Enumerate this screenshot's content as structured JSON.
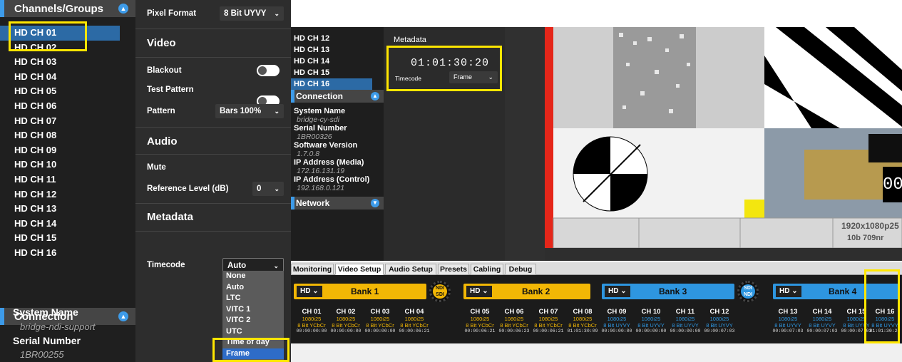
{
  "left_panel": {
    "channels_header": "Channels/Groups",
    "channels": [
      "HD CH 01",
      "HD CH 02",
      "HD CH 03",
      "HD CH 04",
      "HD CH 05",
      "HD CH 06",
      "HD CH 07",
      "HD CH 08",
      "HD CH 09",
      "HD CH 10",
      "HD CH 11",
      "HD CH 12",
      "HD CH 13",
      "HD CH 14",
      "HD CH 15",
      "HD CH 16"
    ],
    "connection_header": "Connection",
    "system_name_label": "System Name",
    "system_name": "bridge-ndi-support",
    "serial_label": "Serial Number",
    "serial": "1BR00255",
    "pixel_format_label": "Pixel Format",
    "pixel_format": "8 Bit UYVY",
    "video_header": "Video",
    "blackout_label": "Blackout",
    "test_pattern_label": "Test Pattern",
    "pattern_label": "Pattern",
    "pattern": "Bars 100%",
    "audio_header": "Audio",
    "mute_label": "Mute",
    "ref_level_label": "Reference Level (dB)",
    "ref_level": "0",
    "metadata_header": "Metadata",
    "timecode_label": "Timecode",
    "timecode_value": "Auto",
    "timecode_options": [
      "None",
      "Auto",
      "LTC",
      "VITC 1",
      "VITC 2",
      "UTC",
      "Time of day",
      "Frame"
    ]
  },
  "right_panel": {
    "channels": [
      "HD CH 12",
      "HD CH 13",
      "HD CH 14",
      "HD CH 15",
      "HD CH 16"
    ],
    "connection_header": "Connection",
    "system_name_label": "System Name",
    "system_name": "bridge-cy-sdi",
    "serial_label": "Serial Number",
    "serial": "1BR00326",
    "software_label": "Software Version",
    "software": "1.7.0.8",
    "ip_media_label": "IP Address (Media)",
    "ip_media": "172.16.131.19",
    "ip_control_label": "IP Address (Control)",
    "ip_control": "192.168.0.121",
    "network_header": "Network",
    "metadata_title": "Metadata",
    "timecode_display": "01:01:30:20",
    "timecode_label": "Timecode",
    "timecode_value": "Frame",
    "preview_texts": [
      "1920x1080p25",
      "10b 709nr",
      "00"
    ],
    "tabs": [
      "Monitoring",
      "Video Setup",
      "Audio Setup",
      "Presets",
      "Cabling",
      "Debug"
    ],
    "active_tab": "Video Setup",
    "banks": [
      {
        "dd": "HD",
        "name": "Bank 1",
        "color": "#f2b705"
      },
      {
        "dd": "HD",
        "name": "Bank 2",
        "color": "#f2b705"
      },
      {
        "dd": "HD",
        "name": "Bank 3",
        "color": "#2e96e0"
      },
      {
        "dd": "HD",
        "name": "Bank 4",
        "color": "#2e96e0"
      }
    ],
    "converters": [
      {
        "top": "NDI",
        "bottom": "SDI"
      },
      {
        "top": "SDI",
        "bottom": "NDI"
      }
    ],
    "channel_cells": [
      {
        "n": "CH 01",
        "r": "1080i25",
        "f": "8 Bit YCbCr",
        "t": "00:00:00:00"
      },
      {
        "n": "CH 02",
        "r": "1080i25",
        "f": "8 Bit YCbCr",
        "t": "00:00:00:00"
      },
      {
        "n": "CH 03",
        "r": "1080i25",
        "f": "8 Bit YCbCr",
        "t": "00:00:00:00"
      },
      {
        "n": "CH 04",
        "r": "1080i25",
        "f": "8 Bit YCbCr",
        "t": "00:00:06:21"
      },
      {
        "n": "CH 05",
        "r": "1080i25",
        "f": "8 Bit YCbCr",
        "t": "00:00:06:21"
      },
      {
        "n": "CH 06",
        "r": "1080i25",
        "f": "8 Bit YCbCr",
        "t": "00:00:06:23"
      },
      {
        "n": "CH 07",
        "r": "1080i25",
        "f": "8 Bit YCbCr",
        "t": "00:00:06:21"
      },
      {
        "n": "CH 08",
        "r": "1080i25",
        "f": "8 Bit YCbCr",
        "t": "01:01:30:09"
      },
      {
        "n": "CH 09",
        "r": "1080i25",
        "f": "8 Bit UYVY",
        "t": "00:00:00:00"
      },
      {
        "n": "CH 10",
        "r": "1080i25",
        "f": "8 Bit UYVY",
        "t": "00:00:00:00"
      },
      {
        "n": "CH 11",
        "r": "1080i25",
        "f": "8 Bit UYVY",
        "t": "00:00:00:00"
      },
      {
        "n": "CH 12",
        "r": "1080i25",
        "f": "8 Bit UYVY",
        "t": "00:00:07:03"
      },
      {
        "n": "CH 13",
        "r": "1080i25",
        "f": "8 Bit UYVY",
        "t": "00:00:07:03"
      },
      {
        "n": "CH 14",
        "r": "1080i25",
        "f": "8 Bit UYVY",
        "t": "00:00:07:03"
      },
      {
        "n": "CH 15",
        "r": "1080i25",
        "f": "8 Bit UYVY",
        "t": "00:00:07:03"
      },
      {
        "n": "CH 16",
        "r": "1080i25",
        "f": "8 Bit UYVY",
        "t": "01:01:30:20"
      }
    ]
  },
  "colors": {
    "accent": "#3d9be9",
    "highlight": "#ffe600",
    "ycbcr": "#f2b705",
    "uyvy": "#2e96e0"
  }
}
